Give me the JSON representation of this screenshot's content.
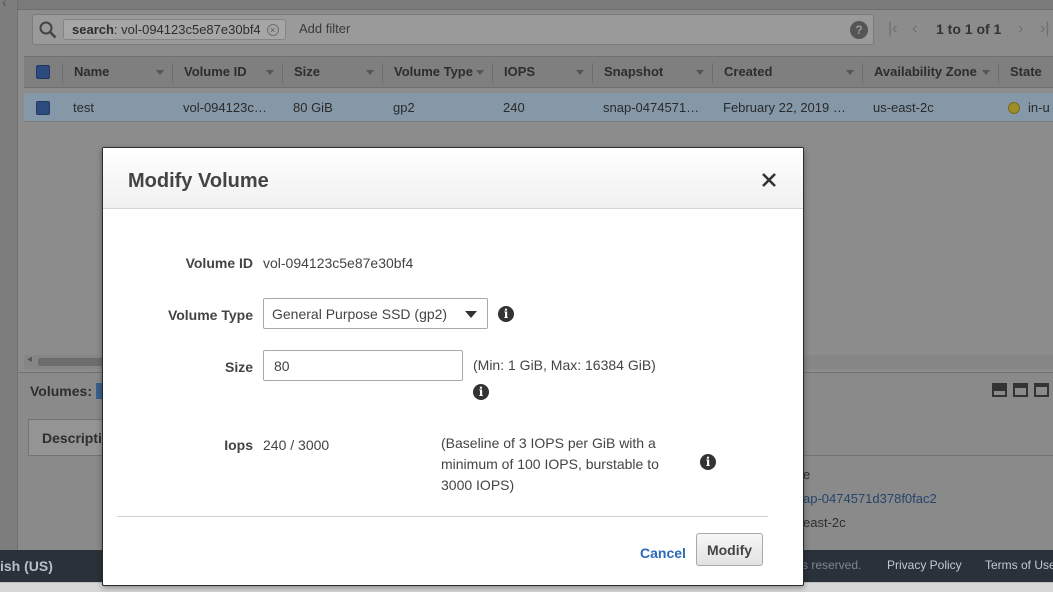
{
  "search": {
    "chip_key": "search",
    "chip_value": ": vol-094123c5e87e30bf4",
    "add_filter_placeholder": "Add filter"
  },
  "pagination": {
    "text": "1 to 1 of 1"
  },
  "table": {
    "columns": [
      "Name",
      "Volume ID",
      "Size",
      "Volume Type",
      "IOPS",
      "Snapshot",
      "Created",
      "Availability Zone",
      "State"
    ],
    "rows": [
      {
        "name": "test",
        "volume_id": "vol-094123c…",
        "size": "80 GiB",
        "volume_type": "gp2",
        "iops": "240",
        "snapshot": "snap-0474571…",
        "created": "February 22, 2019 …",
        "availability_zone": "us-east-2c",
        "state": "in-u"
      }
    ]
  },
  "detail_pane": {
    "volumes_label": "Volumes:",
    "description_tab": "Description",
    "right_fragments": [
      "e",
      "ap-0474571d378f0fac2",
      "east-2c"
    ]
  },
  "footer": {
    "language": "ish (US)",
    "rights": "s reserved.",
    "privacy": "Privacy Policy",
    "terms": "Terms of Use"
  },
  "modal": {
    "title": "Modify Volume",
    "volume_id_label": "Volume ID",
    "volume_id_value": "vol-094123c5e87e30bf4",
    "volume_type_label": "Volume Type",
    "volume_type_value": "General Purpose SSD (gp2)",
    "size_label": "Size",
    "size_value": "80",
    "size_hint": "(Min: 1 GiB, Max: 16384 GiB)",
    "iops_label": "Iops",
    "iops_value": "240 / 3000",
    "iops_hint_lines": [
      "(Baseline of 3 IOPS per GiB with a",
      "minimum of 100 IOPS, burstable to",
      "3000 IOPS)"
    ],
    "cancel_label": "Cancel",
    "modify_label": "Modify"
  },
  "colors": {
    "link": "#2a6ab8",
    "footer_bg": "#2a313a",
    "overlay_gray": "#8c8c8c"
  },
  "icons": [
    "search-icon",
    "chip-remove-icon",
    "help-icon",
    "first-page-icon",
    "prev-page-icon",
    "next-page-icon",
    "last-page-icon",
    "close-icon",
    "info-icon",
    "dropdown-caret-icon"
  ]
}
